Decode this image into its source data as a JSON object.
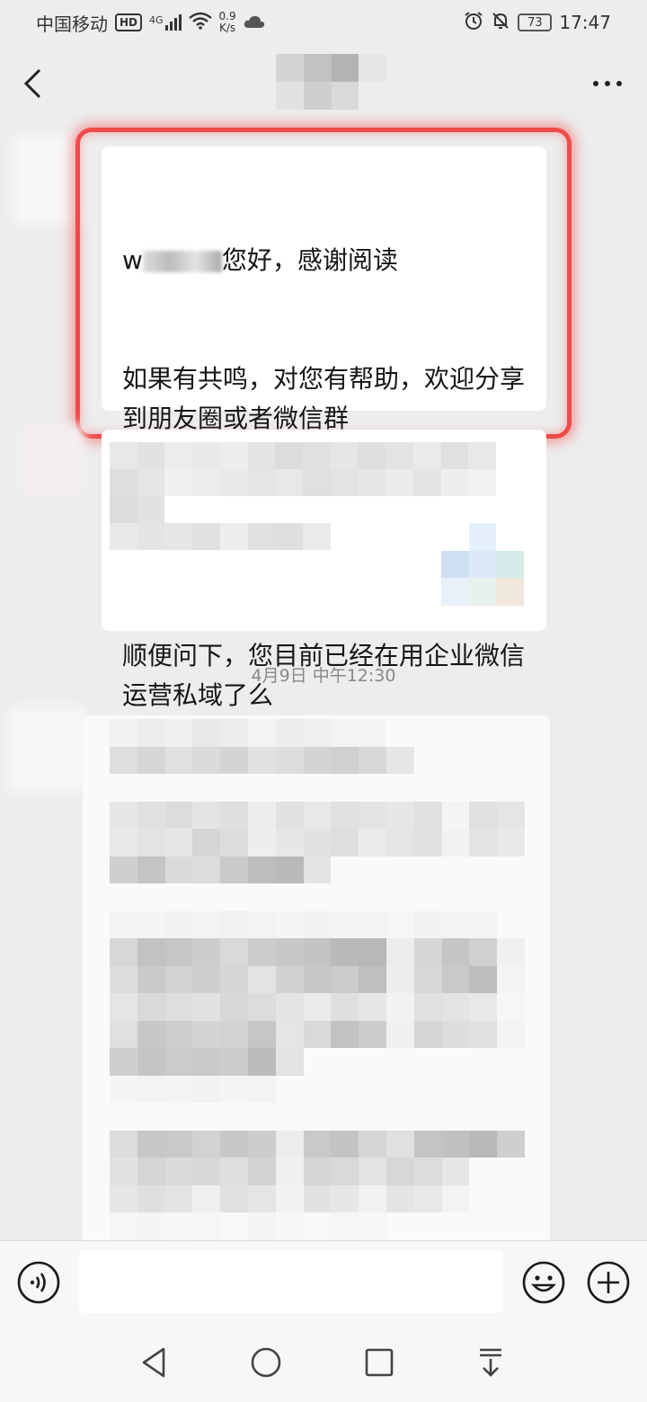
{
  "status_bar": {
    "carrier": "中国移动",
    "hd": "HD",
    "signal_type": "4G",
    "net_speed_value": "0.9",
    "net_speed_unit": "K/s",
    "battery": "73",
    "time": "17:47"
  },
  "nav": {
    "title": ""
  },
  "messages": {
    "highlighted": {
      "name_prefix": "w",
      "greeting": "您好，感谢阅读",
      "line1": "如果有共鸣，对您有帮助，欢迎分享到朋友圈或者微信群",
      "line2": "顺便问下，您目前已经在用企业微信运营私域了么"
    },
    "timestamp": "4月9日 中午12:30"
  },
  "input": {
    "placeholder": "",
    "value": ""
  },
  "colors": {
    "background": "#ededed",
    "bubble": "#ffffff",
    "highlight": "#f04b4b"
  },
  "icons": {
    "back": "chevron-left-icon",
    "more": "more-dots-icon",
    "voice": "voice-icon",
    "emoji": "emoji-icon",
    "plus": "plus-icon",
    "alarm": "alarm-icon",
    "mute": "bell-off-icon",
    "wifi": "wifi-icon",
    "cloud": "cloud-icon"
  }
}
